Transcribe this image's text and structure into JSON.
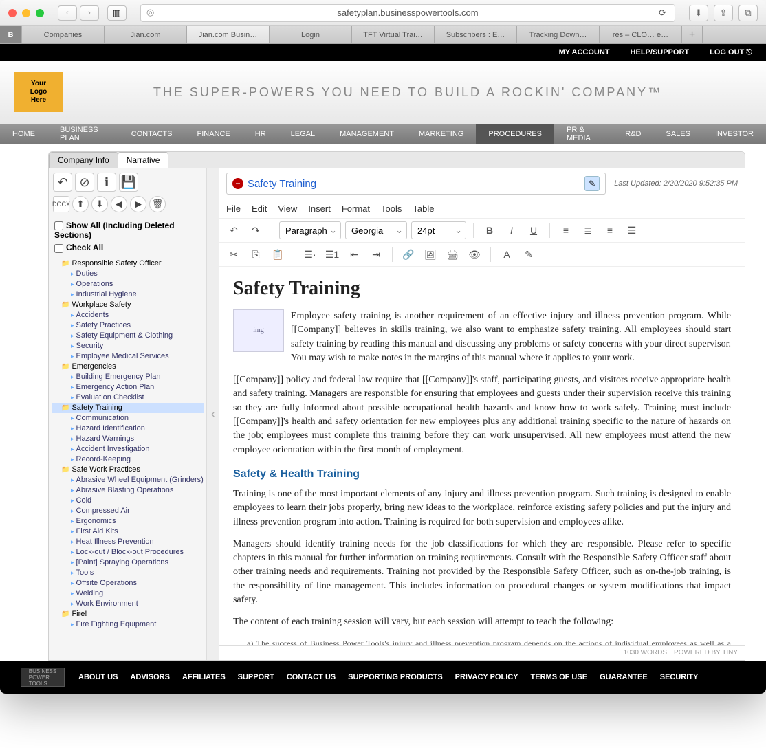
{
  "browser": {
    "url": "safetyplan.businesspowertools.com",
    "tabs": [
      "Companies",
      "Jian.com",
      "Jian.com Busin…",
      "Login",
      "TFT Virtual Trai…",
      "Subscribers : E…",
      "Tracking Down…",
      "res – CLO…  e…"
    ],
    "active_tab_index": 2
  },
  "topstrip": {
    "account": "MY ACCOUNT",
    "help": "HELP/SUPPORT",
    "logout": "LOG OUT"
  },
  "logo_lines": [
    "Your",
    "Logo",
    "Here"
  ],
  "tagline": "THE SUPER-POWERS YOU NEED TO BUILD A ROCKIN' COMPANY™",
  "mainnav": [
    "HOME",
    "BUSINESS PLAN",
    "CONTACTS",
    "FINANCE",
    "HR",
    "LEGAL",
    "MANAGEMENT",
    "MARKETING",
    "PROCEDURES",
    "PR & MEDIA",
    "R&D",
    "SALES",
    "INVESTOR"
  ],
  "mainnav_active": 8,
  "doctabs": {
    "company": "Company Info",
    "narrative": "Narrative"
  },
  "left": {
    "show_all": "Show All (Including Deleted Sections)",
    "check_all": "Check All",
    "tree": [
      {
        "t": "Responsible Safety Officer",
        "f": true
      },
      {
        "t": "Duties"
      },
      {
        "t": "Operations"
      },
      {
        "t": "Industrial Hygiene"
      },
      {
        "t": "Workplace Safety",
        "f": true
      },
      {
        "t": "Accidents"
      },
      {
        "t": "Safety Practices"
      },
      {
        "t": "Safety Equipment & Clothing"
      },
      {
        "t": "Security"
      },
      {
        "t": "Employee Medical Services"
      },
      {
        "t": "Emergencies",
        "f": true
      },
      {
        "t": "Building Emergency Plan"
      },
      {
        "t": "Emergency Action Plan"
      },
      {
        "t": "Evaluation Checklist"
      },
      {
        "t": "Safety Training",
        "f": true,
        "sel": true
      },
      {
        "t": "Communication"
      },
      {
        "t": "Hazard Identification"
      },
      {
        "t": "Hazard Warnings"
      },
      {
        "t": "Accident Investigation"
      },
      {
        "t": "Record-Keeping"
      },
      {
        "t": "Safe Work Practices",
        "f": true
      },
      {
        "t": "Abrasive Wheel Equipment (Grinders)"
      },
      {
        "t": "Abrasive Blasting Operations"
      },
      {
        "t": "Cold"
      },
      {
        "t": "Compressed Air"
      },
      {
        "t": "Ergonomics"
      },
      {
        "t": "First Aid Kits"
      },
      {
        "t": "Heat Illness Prevention"
      },
      {
        "t": "Lock-out / Block-out Procedures"
      },
      {
        "t": "[Paint] Spraying Operations"
      },
      {
        "t": "Tools"
      },
      {
        "t": "Offsite Operations"
      },
      {
        "t": "Welding"
      },
      {
        "t": "Work Environment"
      },
      {
        "t": "Fire!",
        "f": true
      },
      {
        "t": "Fire Fighting Equipment"
      }
    ]
  },
  "right": {
    "title": "Safety Training",
    "updated": "Last Updated: 2/20/2020 9:52:35 PM",
    "menus": [
      "File",
      "Edit",
      "View",
      "Insert",
      "Format",
      "Tools",
      "Table"
    ],
    "format_sel": "Paragraph",
    "font_sel": "Georgia",
    "size_sel": "24pt",
    "h1": "Safety Training",
    "p1": "Employee safety training is another requirement of an effective injury and illness prevention program. While [[Company]] believes in skills training, we also want to emphasize safety training. All employees should start safety training by reading this manual and discussing any problems or safety concerns with your direct supervisor. You may wish to make notes in the margins of this manual where it applies to your work.",
    "p2": "[[Company]] policy and federal law require that [[Company]]'s staff, participating guests, and visitors receive appropriate health and safety training. Managers are responsible for ensuring that employees and guests under their supervision receive this training so they are fully informed about possible occupational health hazards and know how to work safely. Training must include [[Company]]'s health and safety orientation for new employees plus any additional training specific to the nature of hazards on the job; employees must complete this training before they can work unsupervised. All new employees must attend the new employee orientation within the first month of employment.",
    "h3": "Safety & Health Training",
    "p3": "Training is one of the most important elements of any injury and illness prevention program. Such training is designed to enable employees to learn their jobs properly, bring new ideas to the workplace, reinforce existing safety policies and put the injury and illness prevention program into action. Training is required for both supervision and employees alike.",
    "p4": "Managers should identify training needs for the job classifications for which they are responsible. Please refer to specific chapters in this manual for further information on training requirements. Consult with the Responsible Safety Officer staff about other training needs and requirements. Training not provided by the Responsible Safety Officer, such as on-the-job training, is the responsibility of line management. This includes information on procedural changes or system modifications that impact safety.",
    "p5": "The content of each training session will vary, but each session will attempt to teach the following:",
    "p6": "a) The success of Business Power Tools's injury and illness prevention program depends on the actions of individual employees as well as a commitment by the Company.",
    "status_words": "1030 WORDS",
    "status_powered": "POWERED BY TINY"
  },
  "footer": [
    "ABOUT US",
    "ADVISORS",
    "AFFILIATES",
    "SUPPORT",
    "CONTACT US",
    "SUPPORTING PRODUCTS",
    "PRIVACY POLICY",
    "TERMS OF USE",
    "GUARANTEE",
    "SECURITY"
  ]
}
